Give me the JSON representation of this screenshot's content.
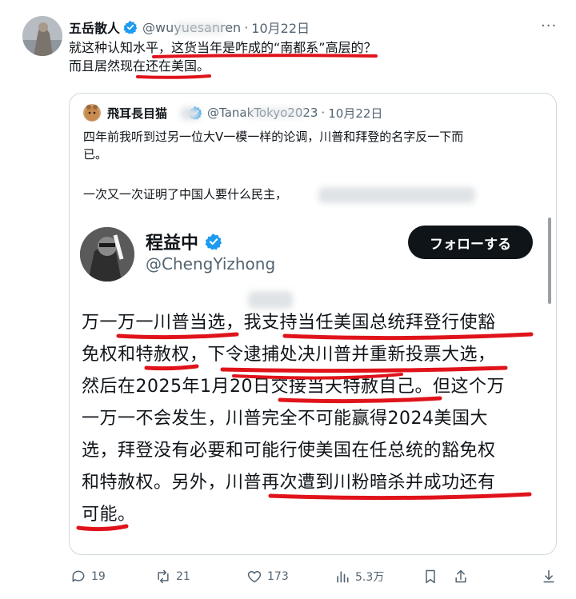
{
  "tweet": {
    "author_name": "五岳散人",
    "handle": "@wuyuesanren",
    "date": "10月22日",
    "more_label": "···",
    "lines": [
      "就这种认知水平，这货当年是咋成的“南都系”高层的？",
      "而且居然现在还在美国。"
    ]
  },
  "quote": {
    "author_name": "飛耳長目猫",
    "handle": "@TanakTokyo2023",
    "date": "10月22日",
    "lines": [
      "四年前我听到过另一位大V一模一样的论调，川普和拜登的名字反一下而",
      "已。",
      "一次又一次证明了中国人要什么民主，"
    ]
  },
  "embedded": {
    "name": "程益中",
    "handle": "@ChengYizhong",
    "follow_label": "フォローする",
    "lines": [
      "万一万一川普当选，我支持当任美国总统拜登行使豁",
      "免权和特赦权，下令逮捕处决川普并重新投票大选，",
      "然后在2025年1月20日交接当天特赦自己。但这个万",
      "一万一不会发生，川普完全不可能赢得2024美国大",
      "选，拜登没有必要和可能行使美国在任总统的豁免权",
      "和特赦权。另外，川普再次遭到川粉暗杀并成功还有",
      "可能。"
    ]
  },
  "actions": {
    "replies": "19",
    "retweets": "21",
    "likes": "173",
    "views": "5.3万"
  },
  "colors": {
    "text": "#0f1419",
    "muted": "#536471",
    "verified": "#1d9bf0",
    "underline": "#e0131b",
    "border": "#cfd9de"
  },
  "icons": [
    "verified-badge-icon",
    "more-icon",
    "reply-icon",
    "retweet-icon",
    "like-icon",
    "views-icon",
    "bookmark-icon",
    "share-icon",
    "download-icon"
  ]
}
